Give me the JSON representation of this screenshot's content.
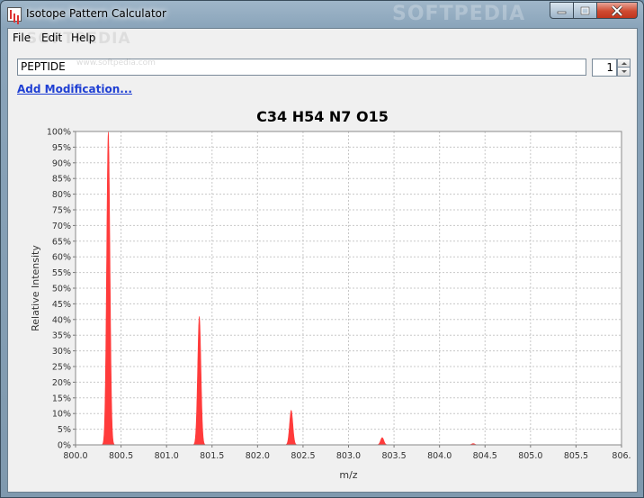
{
  "window": {
    "title": "Isotope Pattern Calculator",
    "watermark": "SOFTPEDIA"
  },
  "menu": {
    "items": [
      "File",
      "Edit",
      "Help"
    ],
    "watermark": "SOFTPEDIA"
  },
  "form": {
    "sequence_value": "PEPTIDE",
    "input_watermark": "www.softpedia.com",
    "charge_value": "1",
    "add_modification_label": "Add Modification..."
  },
  "icons": {
    "app": "histogram-icon",
    "minimize": "minimize-icon",
    "maximize": "maximize-icon",
    "close": "close-icon"
  },
  "colors": {
    "peak": "#ff3b3b",
    "link": "#1f3fd3",
    "close_button": "#c8412a"
  },
  "chart_data": {
    "type": "area",
    "title": "C34 H54 N7 O15",
    "xlabel": "m/z",
    "ylabel": "Relative Intensity",
    "xlim": [
      800.0,
      806.0
    ],
    "ylim": [
      0,
      100
    ],
    "x_ticks": [
      "800.0",
      "800.5",
      "801.0",
      "801.5",
      "802.0",
      "802.5",
      "803.0",
      "803.5",
      "804.0",
      "804.5",
      "805.0",
      "805.5",
      "806."
    ],
    "y_ticks": [
      "0%",
      "5%",
      "10%",
      "15%",
      "20%",
      "25%",
      "30%",
      "35%",
      "40%",
      "45%",
      "50%",
      "55%",
      "60%",
      "65%",
      "70%",
      "75%",
      "80%",
      "85%",
      "90%",
      "95%",
      "100%"
    ],
    "grid": true,
    "peaks": [
      {
        "mz": 800.36,
        "intensity": 100
      },
      {
        "mz": 801.36,
        "intensity": 41
      },
      {
        "mz": 802.37,
        "intensity": 11
      },
      {
        "mz": 803.37,
        "intensity": 2.3
      },
      {
        "mz": 804.37,
        "intensity": 0.4
      }
    ]
  }
}
